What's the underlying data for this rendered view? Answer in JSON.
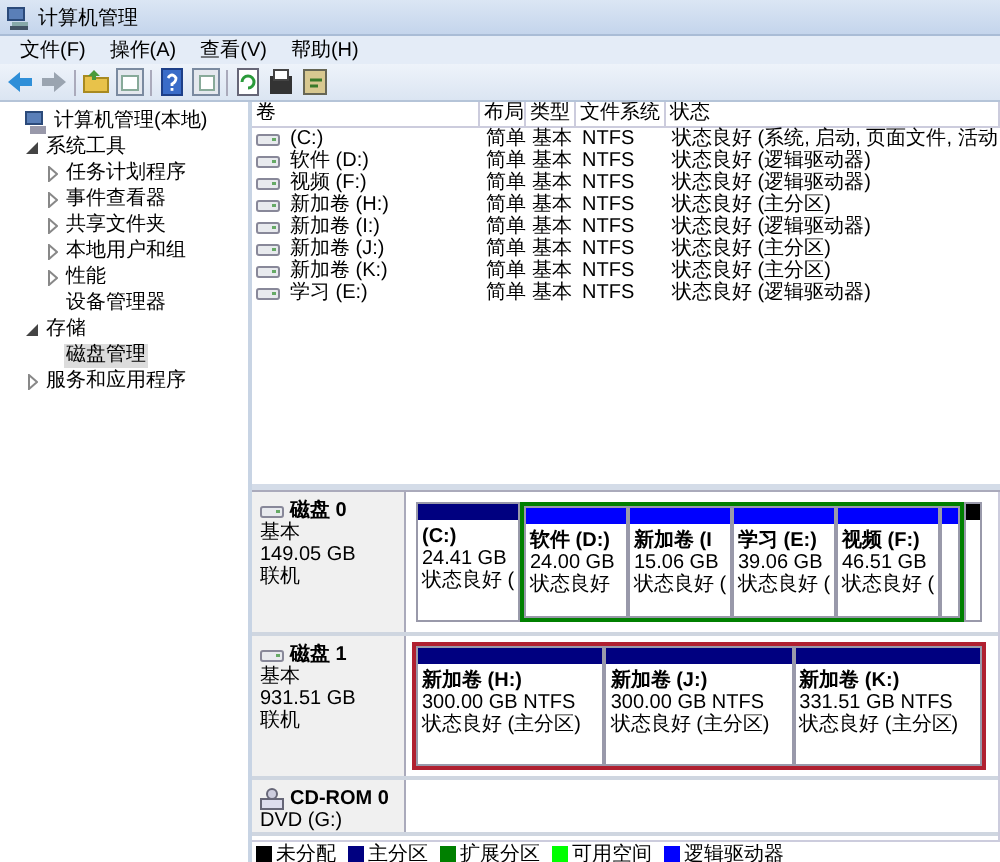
{
  "window": {
    "title": "计算机管理"
  },
  "menu": [
    "文件(F)",
    "操作(A)",
    "查看(V)",
    "帮助(H)"
  ],
  "tree": [
    {
      "label": "计算机管理(本地)",
      "selected": false,
      "children": [
        {
          "label": "系统工具",
          "expanded": true,
          "selected": false,
          "children": [
            {
              "label": "任务计划程序",
              "expanded": false,
              "selected": false
            },
            {
              "label": "事件查看器",
              "expanded": false,
              "selected": false
            },
            {
              "label": "共享文件夹",
              "expanded": false,
              "selected": false
            },
            {
              "label": "本地用户和组",
              "expanded": false,
              "selected": false
            },
            {
              "label": "性能",
              "expanded": false,
              "selected": false
            },
            {
              "label": "设备管理器",
              "selected": false
            }
          ]
        },
        {
          "label": "存储",
          "expanded": true,
          "selected": false,
          "children": [
            {
              "label": "磁盘管理",
              "selected": true
            }
          ]
        },
        {
          "label": "服务和应用程序",
          "expanded": false,
          "selected": false
        }
      ]
    }
  ],
  "volumes": {
    "columns": [
      "卷",
      "布局",
      "类型",
      "文件系统",
      "状态"
    ],
    "rows": [
      {
        "cells": [
          "(C:)",
          "简单",
          "基本",
          "NTFS",
          "状态良好 (系统, 启动, 页面文件, 活动"
        ]
      },
      {
        "cells": [
          "软件 (D:)",
          "简单",
          "基本",
          "NTFS",
          "状态良好 (逻辑驱动器)"
        ]
      },
      {
        "cells": [
          "视频 (F:)",
          "简单",
          "基本",
          "NTFS",
          "状态良好 (逻辑驱动器)"
        ]
      },
      {
        "cells": [
          "新加卷 (H:)",
          "简单",
          "基本",
          "NTFS",
          "状态良好 (主分区)"
        ]
      },
      {
        "cells": [
          "新加卷 (I:)",
          "简单",
          "基本",
          "NTFS",
          "状态良好 (逻辑驱动器)"
        ]
      },
      {
        "cells": [
          "新加卷 (J:)",
          "简单",
          "基本",
          "NTFS",
          "状态良好 (主分区)"
        ]
      },
      {
        "cells": [
          "新加卷 (K:)",
          "简单",
          "基本",
          "NTFS",
          "状态良好 (主分区)"
        ]
      },
      {
        "cells": [
          "学习 (E:)",
          "简单",
          "基本",
          "NTFS",
          "状态良好 (逻辑驱动器)"
        ]
      }
    ]
  },
  "disks": [
    {
      "kind": "hdd",
      "name": "磁盘 0",
      "type": "基本",
      "size": "149.05 GB",
      "status": "联机",
      "highlighted": false,
      "partitions": [
        {
          "kind": "primary",
          "name": "(C:)",
          "size": "24.41 GB",
          "status": "状态良好 ("
        },
        {
          "kind": "extended",
          "partitions": [
            {
              "kind": "logical",
              "name": "软件 (D:)",
              "size": "24.00 GB",
              "status": "状态良好"
            },
            {
              "kind": "logical",
              "name": "新加卷 (I",
              "size": "15.06 GB",
              "status": "状态良好 ("
            },
            {
              "kind": "logical",
              "name": "学习 (E:)",
              "size": "39.06 GB",
              "status": "状态良好 ("
            },
            {
              "kind": "logical",
              "name": "视频 (F:)",
              "size": "46.51 GB",
              "status": "状态良好 ("
            },
            {
              "kind": "logical"
            }
          ]
        },
        {
          "kind": "unallocated"
        }
      ]
    },
    {
      "kind": "hdd",
      "name": "磁盘 1",
      "type": "基本",
      "size": "931.51 GB",
      "status": "联机",
      "highlighted": true,
      "partitions": [
        {
          "kind": "primary",
          "name": "新加卷 (H:)",
          "size": "300.00 GB NTFS",
          "status": "状态良好 (主分区)"
        },
        {
          "kind": "primary",
          "name": "新加卷 (J:)",
          "size": "300.00 GB NTFS",
          "status": "状态良好 (主分区)"
        },
        {
          "kind": "primary",
          "name": "新加卷 (K:)",
          "size": "331.51 GB NTFS",
          "status": "状态良好 (主分区)"
        }
      ]
    },
    {
      "kind": "cdrom",
      "name": "CD-ROM 0",
      "type": "DVD (G:)"
    }
  ],
  "legend": [
    {
      "label": "未分配",
      "color": "#000000"
    },
    {
      "label": "主分区",
      "color": "#000080"
    },
    {
      "label": "扩展分区",
      "color": "#008000"
    },
    {
      "label": "可用空间",
      "color": "#00ff00"
    },
    {
      "label": "逻辑驱动器",
      "color": "#0000ff"
    }
  ]
}
